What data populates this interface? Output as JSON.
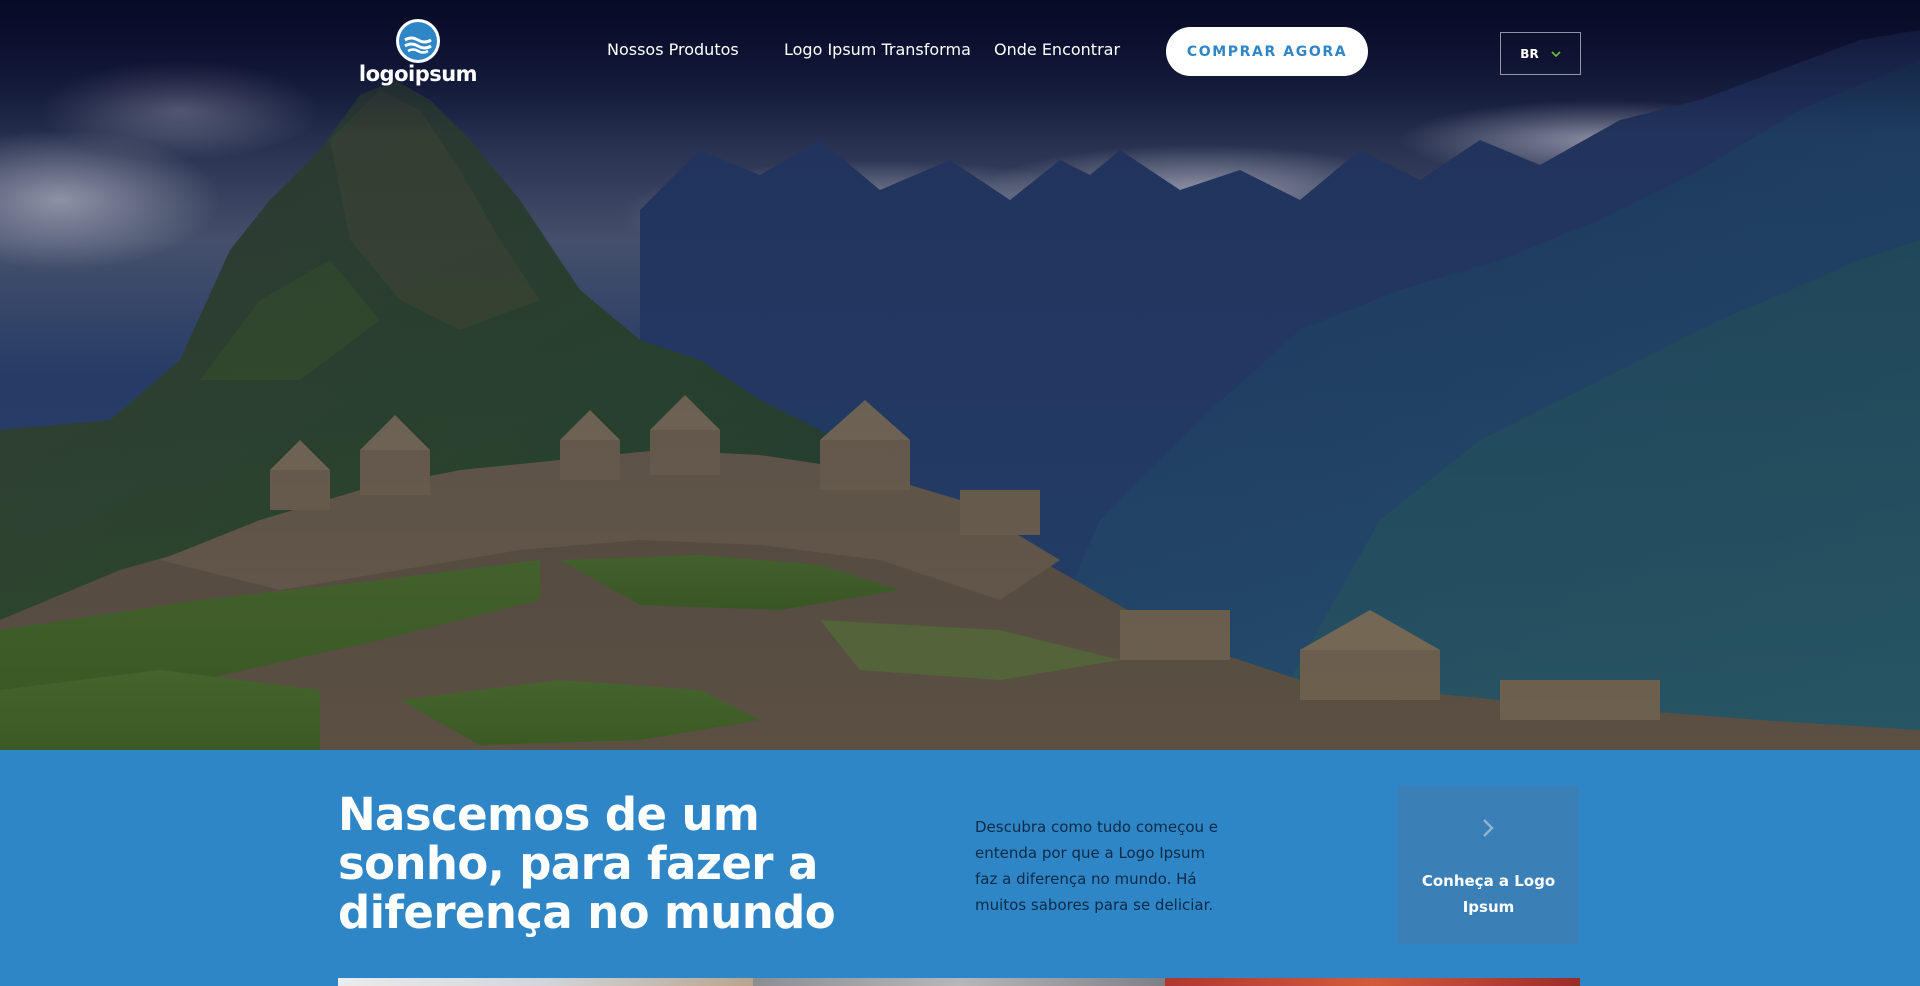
{
  "header": {
    "logo_text": "logoipsum",
    "nav": [
      {
        "label": "Nossos Produtos"
      },
      {
        "label": "Logo Ipsum Transforma"
      },
      {
        "label": "Onde Encontrar"
      }
    ],
    "cta_label": "COMPRAR AGORA",
    "language": {
      "selected": "BR",
      "icon": "chevron-down-icon"
    }
  },
  "intro": {
    "title": "Nascemos de um sonho, para fazer a diferença no mundo",
    "description": "Descubra como tudo começou e entenda por que a Logo Ipsum faz a diferença no mundo. Há muitos sabores para se deliciar.",
    "card": {
      "label": "Conheça a Logo Ipsum",
      "icon": "chevron-right-icon"
    }
  },
  "colors": {
    "brand_blue": "#2f86c6",
    "card_blue": "#3a7fb5",
    "text_dark": "#0e2a47",
    "accent_green": "#6fbf3b"
  }
}
